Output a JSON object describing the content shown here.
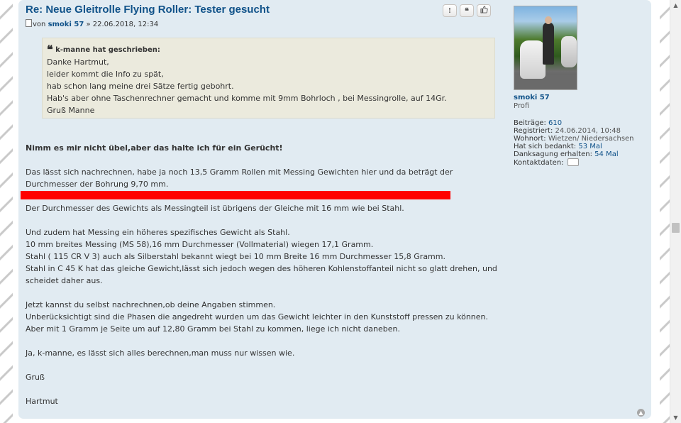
{
  "post": {
    "title": "Re: Neue Gleitrolle Flying Roller: Tester gesucht",
    "byline_prefix": "von",
    "author": "smoki 57",
    "byline_date": "» 22.06.2018, 12:34",
    "actions": [
      {
        "icon": "report-icon",
        "glyph": "!"
      },
      {
        "icon": "quote-icon",
        "glyph": "❝"
      },
      {
        "icon": "thumbs-up-icon",
        "glyph": "👍"
      }
    ]
  },
  "quote": {
    "cite": "k-manne hat geschrieben:",
    "lines": [
      "Danke Hartmut,",
      "leider kommt die Info zu spät,",
      "hab schon lang meine drei Sätze fertig gebohrt.",
      "Hab's aber ohne Taschenrechner gemacht und komme mit 9mm Bohrloch , bei Messingrolle, auf 14Gr.",
      "Gruß Manne"
    ]
  },
  "content": {
    "paragraphs": [
      {
        "bold": true,
        "lines": [
          "Nimm es mir nicht übel,aber das halte ich für ein Gerücht!"
        ]
      },
      {
        "bold": false,
        "lines": [
          "Das lässt sich nachrechnen, habe ja noch 13,5 Gramm Rollen mit Messing Gewichten hier und da beträgt der",
          "Durchmesser der Bohrung 9,70 mm."
        ]
      },
      {
        "bold": false,
        "lines": [
          "Der Durchmesser des Gewichts als Messingteil ist übrigens der Gleiche mit 16 mm wie bei Stahl."
        ]
      },
      {
        "bold": false,
        "lines": [
          "Und zudem hat Messing ein höheres spezifisches Gewicht als Stahl.",
          "10 mm breites Messing (MS 58),16 mm Durchmesser (Vollmaterial) wiegen 17,1 Gramm.",
          "Stahl ( 115 CR V 3) auch als Silberstahl bekannt wiegt bei 10 mm Breite 16 mm Durchmesser 15,8 Gramm.",
          "Stahl in C 45 K hat das gleiche Gewicht,lässt sich jedoch wegen des höheren Kohlenstoffanteil nicht so glatt drehen, und",
          "scheidet daher aus."
        ]
      },
      {
        "bold": false,
        "lines": [
          "Jetzt kannst du selbst nachrechnen,ob deine Angaben stimmen.",
          "Unberücksichtigt sind die Phasen die angedreht wurden um das Gewicht leichter in den Kunststoff pressen zu können.",
          "Aber mit 1 Gramm je Seite um auf 12,80 Gramm bei Stahl zu kommen, liege ich nicht daneben."
        ]
      },
      {
        "bold": false,
        "lines": [
          "Ja, k-manne, es lässt sich alles berechnen,man muss nur wissen wie."
        ]
      },
      {
        "bold": false,
        "lines": [
          "Gruß"
        ]
      },
      {
        "bold": false,
        "lines": [
          "Hartmut"
        ]
      }
    ]
  },
  "profile": {
    "username": "smoki 57",
    "rank": "Profi",
    "fields": [
      {
        "label": "Beiträge:",
        "value": "610",
        "link": true
      },
      {
        "label": "Registriert:",
        "value": "24.06.2014, 10:48",
        "link": false
      },
      {
        "label": "Wohnort:",
        "value": "Wietzen/ Niedersachsen",
        "link": false
      },
      {
        "label": "Hat sich bedankt:",
        "value": "53 Mal",
        "link": true
      },
      {
        "label": "Danksagung erhalten:",
        "value": "54 Mal",
        "link": true
      },
      {
        "label": "Kontaktdaten:",
        "value": "",
        "link": false
      }
    ]
  },
  "colors": {
    "post_bg": "#e1ebf2",
    "title": "#105289",
    "quote_bg": "#ebeadd",
    "highlight_bar": "#ff0000"
  }
}
